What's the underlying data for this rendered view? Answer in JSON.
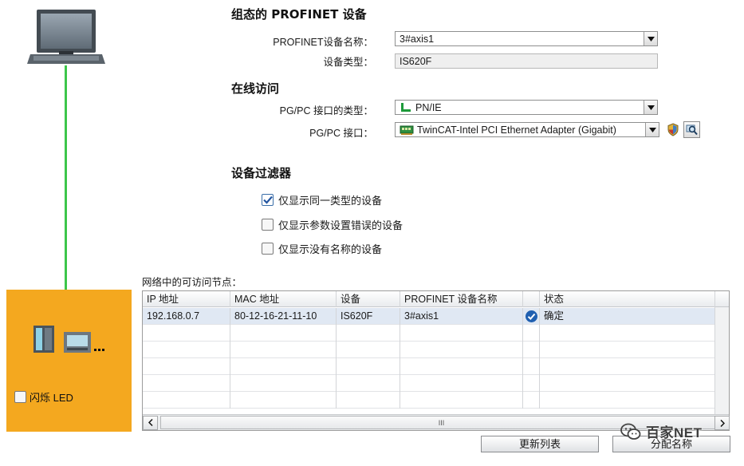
{
  "topology": {
    "flash_led_label": "闪烁 LED",
    "flash_led_checked": false,
    "cable_color": "#3cc64a",
    "device_box_color": "#f4a81f"
  },
  "configured_device": {
    "title": "组态的 PROFINET 设备",
    "name_label": "PROFINET设备名称：",
    "name_value": "3#axis1",
    "type_label": "设备类型：",
    "type_value": "IS620F"
  },
  "online_access": {
    "title": "在线访问",
    "interface_type_label": "PG/PC 接口的类型：",
    "interface_type_value": "PN/IE",
    "interface_label": "PG/PC 接口：",
    "interface_value": "TwinCAT-Intel PCI Ethernet Adapter (Gigabit)"
  },
  "device_filter": {
    "title": "设备过滤器",
    "options": [
      {
        "label": "仅显示同一类型的设备",
        "checked": true
      },
      {
        "label": "仅显示参数设置错误的设备",
        "checked": false
      },
      {
        "label": "仅显示没有名称的设备",
        "checked": false
      }
    ]
  },
  "nodes_table": {
    "label": "网络中的可访问节点：",
    "columns": [
      "IP 地址",
      "MAC 地址",
      "设备",
      "PROFINET 设备名称",
      "状态"
    ],
    "rows": [
      {
        "ip": "192.168.0.7",
        "mac": "80-12-16-21-11-10",
        "device": "IS620F",
        "profinet_name": "3#axis1",
        "status": "确定"
      }
    ],
    "scroll_thumb_glyph": "III"
  },
  "buttons": {
    "refresh": "更新列表",
    "assign_name": "分配名称"
  },
  "watermark": "百家NET"
}
